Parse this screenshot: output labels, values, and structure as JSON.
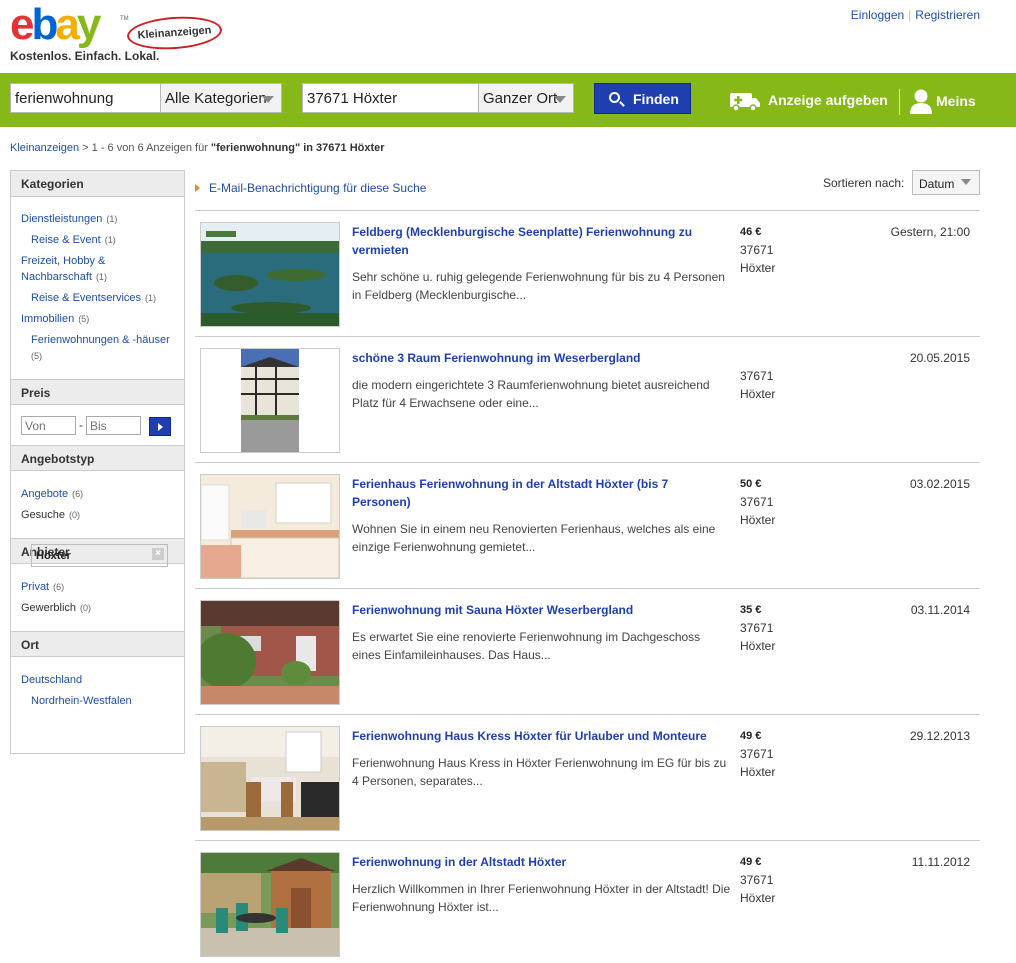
{
  "header": {
    "logo_letters": [
      "e",
      "b",
      "a",
      "y"
    ],
    "logo_tm": "TM",
    "badge": "Kleinanzeigen",
    "tagline": "Kostenlos. Einfach. Lokal.",
    "login": "Einloggen",
    "register": "Registrieren"
  },
  "search": {
    "query": "ferienwohnung",
    "category": "Alle Kategorien",
    "location": "37671 Höxter",
    "radius": "Ganzer Ort",
    "find_label": "Finden",
    "post_ad_label": "Anzeige aufgeben",
    "account_label": "Meins"
  },
  "breadcrumb": {
    "root": "Kleinanzeigen",
    "middle": " > 1 - 6 von 6 Anzeigen für ",
    "term": "\"ferienwohnung\" in 37671 Höxter"
  },
  "sidebar": {
    "categories": {
      "heading": "Kategorien",
      "items": [
        {
          "label": "Dienstleistungen",
          "count": "(1)"
        },
        {
          "label": "Reise & Event",
          "count": "(1)"
        },
        {
          "label1": "Freizeit, Hobby &",
          "label2": "Nachbarschaft",
          "count": "(1)"
        },
        {
          "label": "Reise & Eventservices",
          "count": "(1)"
        },
        {
          "label": "Immobilien",
          "count": "(5)"
        },
        {
          "label": "Ferienwohnungen & -häuser",
          "count": "(5)"
        }
      ]
    },
    "price": {
      "heading": "Preis",
      "from_placeholder": "Von",
      "to_placeholder": "Bis",
      "dash": "-"
    },
    "offer_type": {
      "heading": "Angebotstyp",
      "items": [
        {
          "label": "Angebote",
          "count": "(6)"
        },
        {
          "label": "Gesuche",
          "count": "(0)"
        }
      ]
    },
    "provider": {
      "heading": "Anbieter",
      "items": [
        {
          "label": "Privat",
          "count": "(6)"
        },
        {
          "label": "Gewerblich",
          "count": "(0)"
        }
      ]
    },
    "place": {
      "heading": "Ort",
      "country": "Deutschland",
      "state": "Nordrhein-Westfalen",
      "city": "Höxter"
    }
  },
  "results": {
    "alert_label": "E-Mail-Benachrichtigung für diese Suche",
    "sort_label": "Sortieren nach:",
    "sort_value": "Datum",
    "listings": [
      {
        "title": "Feldberg (Mecklenburgische Seenplatte) Ferienwohnung zu vermieten",
        "description": "Sehr schöne u. ruhig gelegende Ferienwohnung für bis zu 4 Personen in Feldberg (Mecklenburgische...",
        "price": "46 €",
        "zip": "37671",
        "city": "Höxter",
        "date": "Gestern, 21:00",
        "image": "lake-photo"
      },
      {
        "title": "schöne 3 Raum Ferienwohnung im Weserbergland",
        "description": "die modern eingerichtete 3 Raumferienwohnung bietet ausreichend Platz für 4 Erwachsene oder eine...",
        "price": "",
        "zip": "37671",
        "city": "Höxter",
        "date": "20.05.2015",
        "image": "half-timbered-house-photo"
      },
      {
        "title": "Ferienhaus Ferienwohnung in der Altstadt Höxter (bis 7 Personen)",
        "description": "Wohnen Sie in einem neu Renovierten Ferienhaus, welches als eine einzige Ferienwohnung gemietet...",
        "price": "50 €",
        "zip": "37671",
        "city": "Höxter",
        "date": "03.02.2015",
        "image": "kitchen-photo"
      },
      {
        "title": "Ferienwohnung mit Sauna Höxter Weserbergland",
        "description": "Es erwartet Sie eine renovierte Ferienwohnung im Dachgeschoss eines Einfamileinhauses. Das Haus...",
        "price": "35 €",
        "zip": "37671",
        "city": "Höxter",
        "date": "03.11.2014",
        "image": "garden-house-photo"
      },
      {
        "title": "Ferienwohnung Haus Kress Höxter für Urlauber und Monteure",
        "description": "Ferienwohnung Haus Kress in Höxter Ferienwohnung im EG für bis zu 4 Personen, separates...",
        "price": "49 €",
        "zip": "37671",
        "city": "Höxter",
        "date": "29.12.2013",
        "image": "dining-room-photo"
      },
      {
        "title": "Ferienwohnung in der Altstadt Höxter",
        "description": "Herzlich Willkommen in Ihrer Ferienwohnung Höxter in der Altstadt! Die Ferienwohnung Höxter ist...",
        "price": "49 €",
        "zip": "37671",
        "city": "Höxter",
        "date": "11.11.2012",
        "image": "patio-photo"
      }
    ]
  },
  "colors": {
    "brand_green": "#86b817",
    "link_blue": "#1f4ea3",
    "button_blue": "#1f3fb0"
  }
}
